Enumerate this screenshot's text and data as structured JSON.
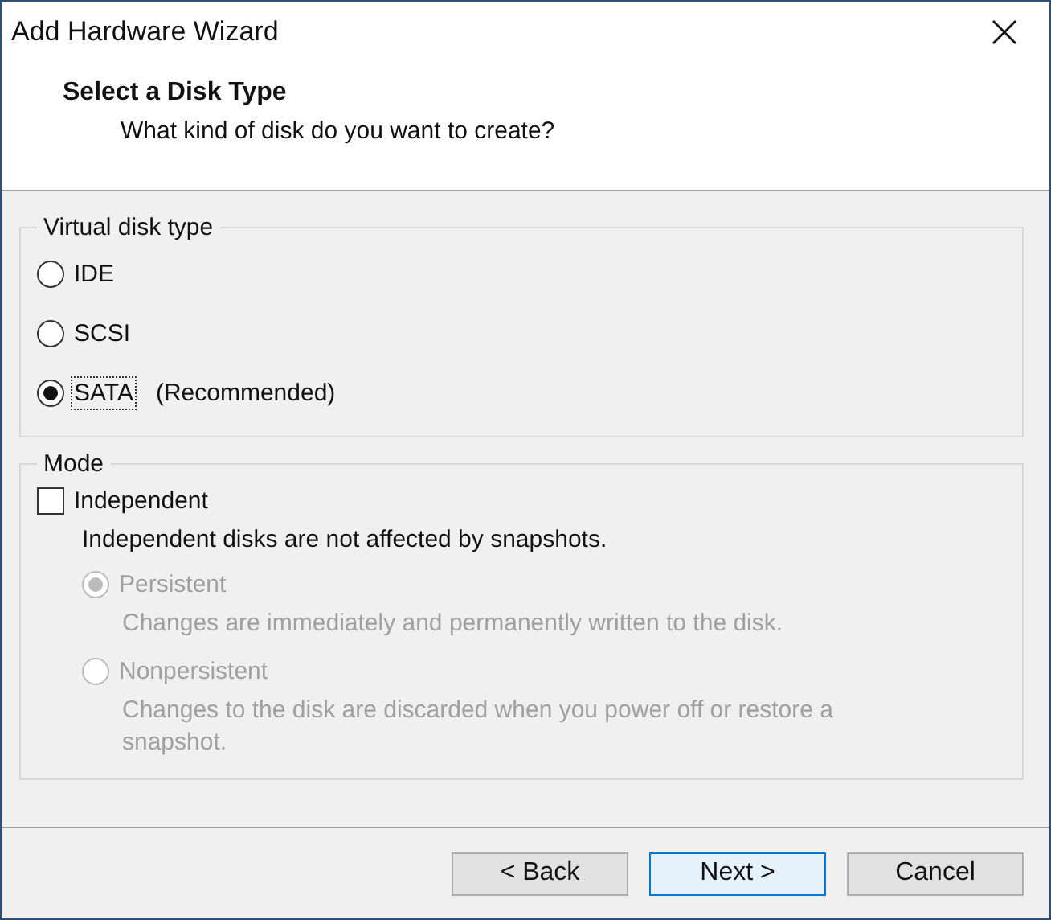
{
  "window": {
    "title": "Add Hardware Wizard"
  },
  "header": {
    "title": "Select a Disk Type",
    "subtitle": "What kind of disk do you want to create?"
  },
  "disk_type": {
    "label": "Virtual disk type",
    "options": [
      {
        "label": "IDE",
        "selected": false,
        "focused": false
      },
      {
        "label": "SCSI",
        "selected": false,
        "focused": false
      },
      {
        "label": "SATA",
        "note": "(Recommended)",
        "selected": true,
        "focused": true
      }
    ]
  },
  "mode": {
    "label": "Mode",
    "independent": {
      "label": "Independent",
      "checked": false
    },
    "description": "Independent disks are not affected by snapshots.",
    "options": [
      {
        "label": "Persistent",
        "description": "Changes are immediately and permanently written to the disk.",
        "selected": true,
        "disabled": true
      },
      {
        "label": "Nonpersistent",
        "description": "Changes to the disk are discarded when you power off or restore a snapshot.",
        "selected": false,
        "disabled": true
      }
    ]
  },
  "buttons": [
    {
      "label": "< Back",
      "kind": "normal"
    },
    {
      "label": "Next >",
      "kind": "default"
    },
    {
      "label": "Cancel",
      "kind": "normal"
    }
  ]
}
